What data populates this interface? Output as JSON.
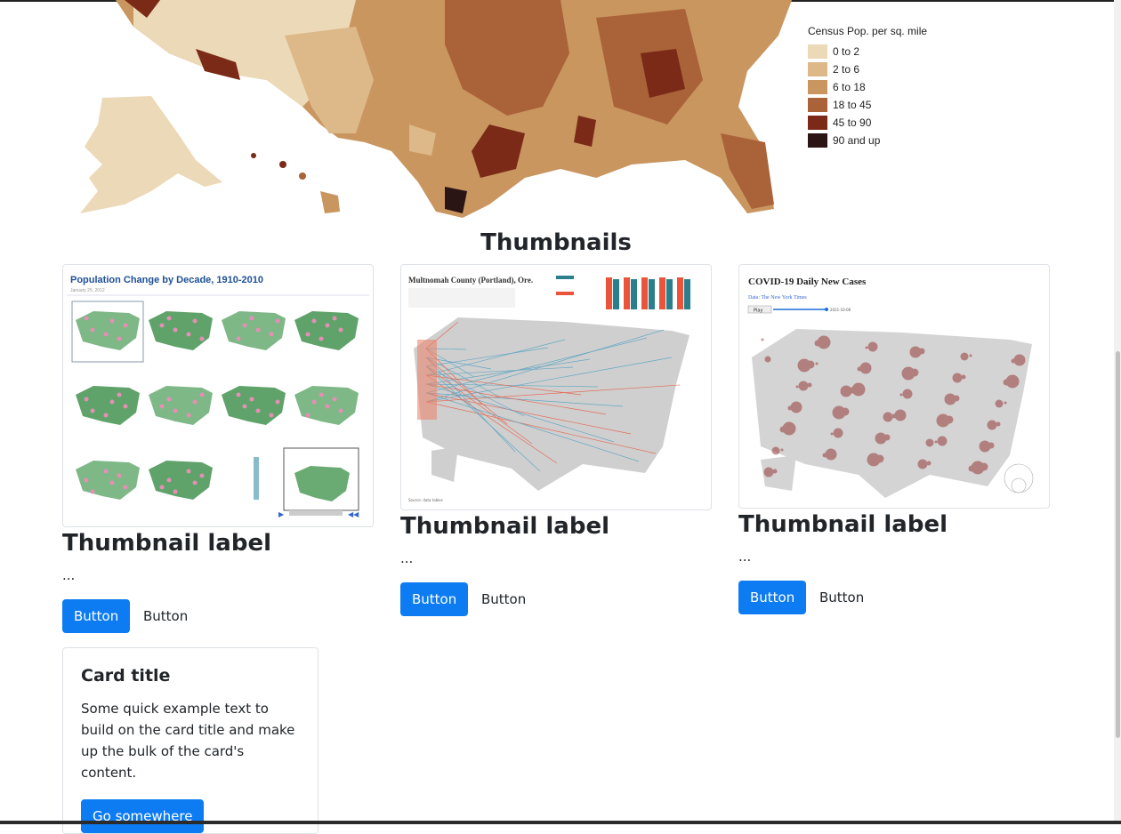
{
  "legend": {
    "title": "Census Pop. per sq. mile",
    "items": [
      {
        "label": "0 to 2",
        "color": "#ecd9b7"
      },
      {
        "label": "2 to 6",
        "color": "#ddb888"
      },
      {
        "label": "6 to 18",
        "color": "#c99660"
      },
      {
        "label": "18 to 45",
        "color": "#aa6238"
      },
      {
        "label": "45 to 90",
        "color": "#7a2a16"
      },
      {
        "label": "90 and up",
        "color": "#2a1414"
      }
    ]
  },
  "section_title": "Thumbnails",
  "thumbnails": [
    {
      "title": "Population Change by Decade, 1910-2010",
      "subtitle": "January 25, 2012",
      "label": "Thumbnail label",
      "text": "...",
      "primary_button": "Button",
      "secondary_button": "Button"
    },
    {
      "title": "Multnomah County (Portland), Ore.",
      "label": "Thumbnail label",
      "text": "...",
      "primary_button": "Button",
      "secondary_button": "Button"
    },
    {
      "title": "COVID-19 Daily New Cases",
      "subtitle": "Data: The New York Times",
      "play": "Play",
      "date": "2021-10-06",
      "label": "Thumbnail label",
      "text": "...",
      "primary_button": "Button",
      "secondary_button": "Button"
    }
  ],
  "card": {
    "title": "Card title",
    "text": "Some quick example text to build on the card title and make up the bulk of the card's content.",
    "button": "Go somewhere"
  },
  "colors": {
    "primary": "#0d7cf2",
    "border": "#dee2e6"
  }
}
